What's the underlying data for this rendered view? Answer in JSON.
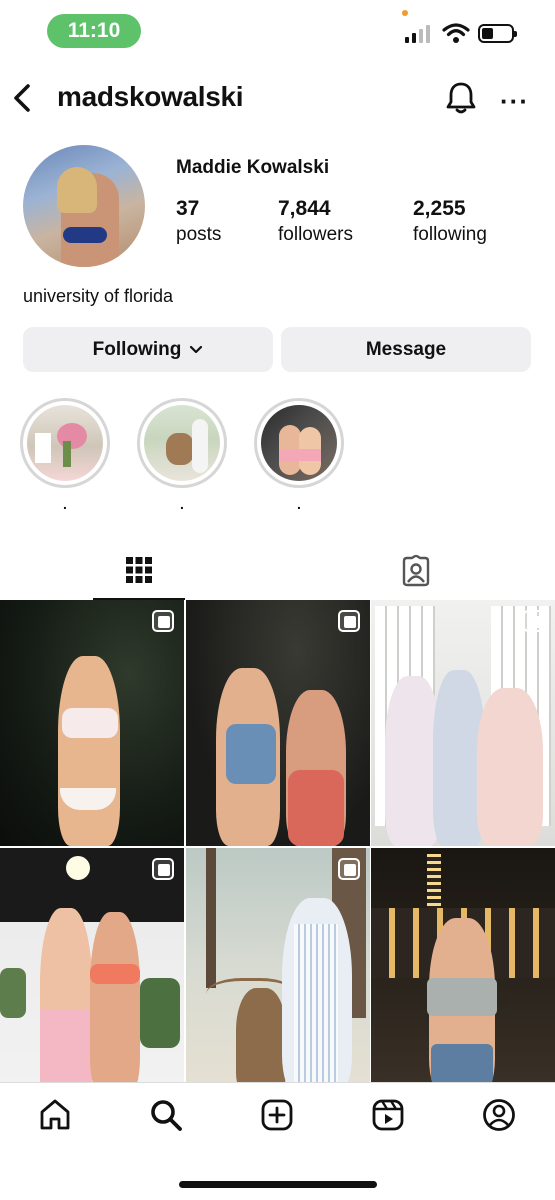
{
  "status_bar": {
    "time": "11:10"
  },
  "header": {
    "username": "madskowalski"
  },
  "profile": {
    "full_name": "Maddie Kowalski",
    "stats": [
      {
        "value": "37",
        "label": "posts"
      },
      {
        "value": "7,844",
        "label": "followers"
      },
      {
        "value": "2,255",
        "label": "following"
      }
    ],
    "bio": "university of florida"
  },
  "actions": {
    "following_label": "Following",
    "message_label": "Message"
  },
  "highlights": [
    {
      "label": "."
    },
    {
      "label": "."
    },
    {
      "label": "."
    }
  ],
  "tabs": [
    {
      "icon": "grid-icon",
      "active": true
    },
    {
      "icon": "tagged-icon",
      "active": false
    }
  ],
  "nav": [
    {
      "icon": "home-icon"
    },
    {
      "icon": "search-icon"
    },
    {
      "icon": "create-icon"
    },
    {
      "icon": "reels-icon"
    },
    {
      "icon": "profile-icon"
    }
  ]
}
